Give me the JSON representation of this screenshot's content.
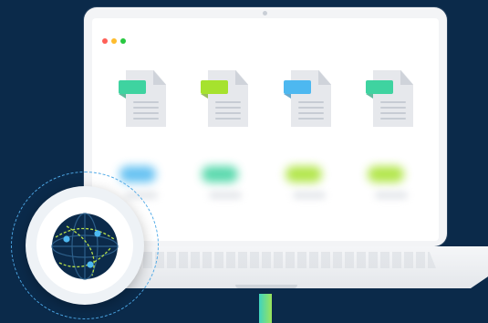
{
  "colors": {
    "background": "#0b2a4a",
    "traffic_lights": [
      "#ff5f57",
      "#febc2e",
      "#28c840"
    ],
    "file_tags": [
      "#3fd3a0",
      "#a6e22e",
      "#4db8f0",
      "#3fd3a0"
    ],
    "blurred_tags": [
      "#4db8f0",
      "#3fd3a0",
      "#a6e22e",
      "#a6e22e"
    ],
    "globe_accent": "#4db8f0",
    "globe_orbit": "#b8e04a",
    "cable": "#3fd3c0"
  },
  "icons": {
    "window_controls": "traffic-lights",
    "files": "document-icon",
    "globe": "globe-network-icon"
  }
}
